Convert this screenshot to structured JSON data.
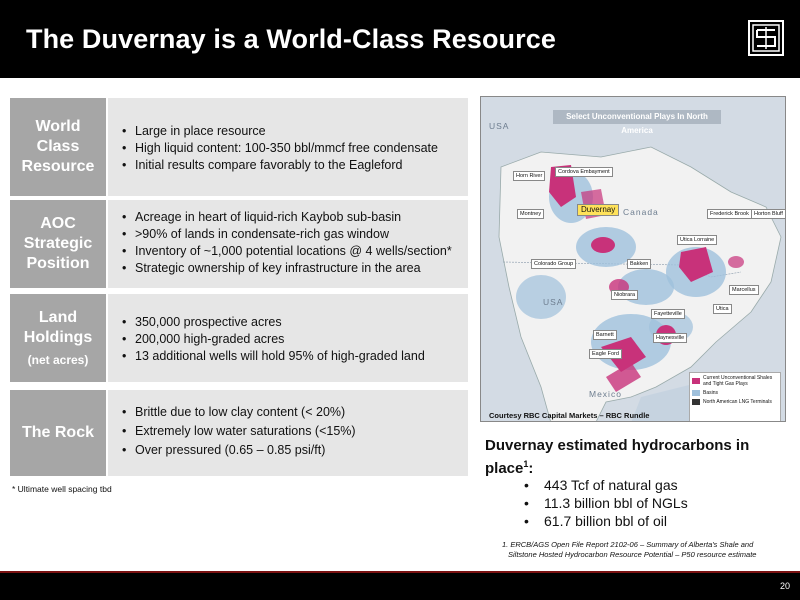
{
  "header": {
    "title": "The Duvernay is a World-Class Resource"
  },
  "rows": [
    {
      "label_lines": [
        "World",
        "Class",
        "Resource"
      ],
      "bullets": [
        "Large in place resource",
        "High liquid content: 100-350 bbl/mmcf free condensate",
        "Initial results compare favorably to the Eagleford"
      ]
    },
    {
      "label_lines": [
        "AOC",
        "Strategic",
        "Position"
      ],
      "bullets": [
        "Acreage in heart of liquid-rich Kaybob sub-basin",
        ">90% of lands in condensate-rich gas window",
        "Inventory of ~1,000 potential locations @ 4 wells/section*",
        "Strategic ownership of key infrastructure in the area"
      ]
    },
    {
      "label_lines": [
        "Land",
        "Holdings"
      ],
      "label_sub": "(net acres)",
      "bullets": [
        "350,000 prospective acres",
        "200,000 high-graded acres",
        "13 additional wells will hold 95% of  high-graded land"
      ]
    },
    {
      "label_lines": [
        "The Rock"
      ],
      "bullets": [
        "Brittle due to low clay content (< 20%)",
        "Extremely low water saturations (<15%)",
        "Over pressured (0.65 – 0.85 psi/ft)"
      ]
    }
  ],
  "footnote_left": "* Ultimate well spacing tbd",
  "map": {
    "title": "Select Unconventional Plays In North America",
    "duvernay_label": "Duvernay",
    "countries": [
      "USA",
      "Canada",
      "USA",
      "Mexico"
    ],
    "play_labels": [
      "Horn River",
      "Cordova Embayment",
      "Montney",
      "Frederick Brook",
      "Horton Bluff",
      "Utica Lorraine",
      "Colorado Group",
      "Bakken",
      "Niobrara",
      "Marcellus",
      "Fayetteville",
      "Utica",
      "Barnett",
      "Haynesville",
      "Eagle Ford"
    ],
    "legend": [
      {
        "label": "Current Unconventional Shales and Tight Gas Plays",
        "color": "#c8327a"
      },
      {
        "label": "Basins",
        "color": "#9fc0dc"
      },
      {
        "label": "North American LNG Terminals",
        "color": "#333333"
      }
    ],
    "courtesy": "Courtesy RBC Capital Markets – RBC Rundle"
  },
  "hydrocarbons": {
    "title": "Duvernay estimated hydrocarbons in place",
    "title_sup": "1",
    "title_suffix": ":",
    "items": [
      "443 Tcf of natural gas",
      "11.3 billion bbl of NGLs",
      "61.7 billion bbl of oil"
    ]
  },
  "source_note": {
    "line1": "1. ERCB/AGS Open File Report 2102-06 – Summary of Alberta's Shale and",
    "line2": "Siltstone Hosted Hydrocarbon Resource Potential – P50 resource estimate"
  },
  "page_number": "20",
  "colors": {
    "header_bg": "#000000",
    "label_bg": "#a6a6a6",
    "content_bg": "#e6e6e6",
    "play_color": "#c8327a",
    "basin_color": "#9fc0dc",
    "duvernay_highlight": "#ffe25a"
  },
  "icons": [
    "company-logo-icon"
  ]
}
